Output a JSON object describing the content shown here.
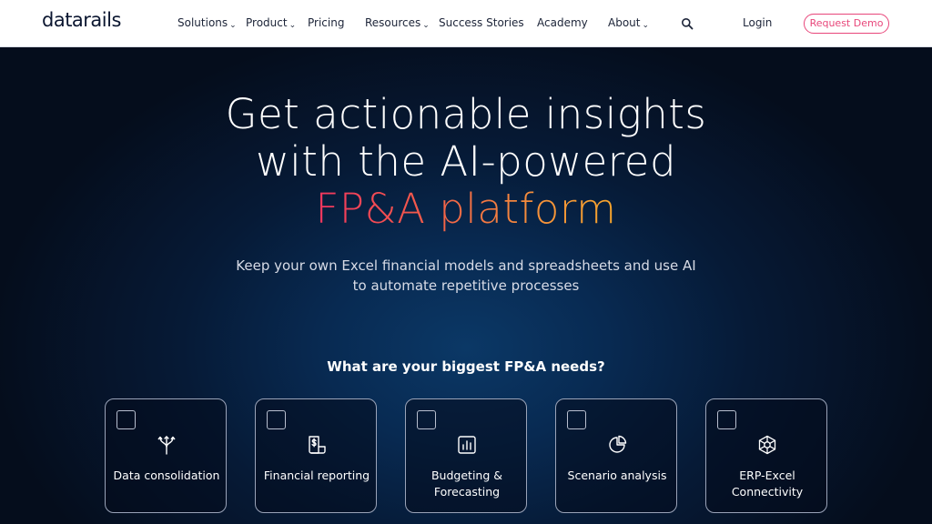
{
  "header": {
    "logo": "datarails",
    "nav": [
      {
        "label": "Solutions",
        "has_dropdown": true
      },
      {
        "label": "Product",
        "has_dropdown": true
      },
      {
        "label": "Pricing",
        "has_dropdown": false
      },
      {
        "label": "Resources",
        "has_dropdown": true
      },
      {
        "label": "Success Stories",
        "has_dropdown": false
      },
      {
        "label": "Academy",
        "has_dropdown": false
      },
      {
        "label": "About",
        "has_dropdown": true
      }
    ],
    "chevron": "⌄",
    "search_icon": "search-icon",
    "login": "Login",
    "cta": "Request Demo"
  },
  "hero": {
    "title_line1": "Get actionable insights",
    "title_line2": "with the AI-powered",
    "title_highlight": "FP&A platform",
    "subtitle_line1": "Keep your own Excel financial models and spreadsheets and use AI",
    "subtitle_line2": "to automate repetitive processes",
    "question": "What are your biggest FP&A needs?"
  },
  "needs": [
    {
      "label_1": "Data consolidation",
      "label_2": "",
      "icon": "merge-icon"
    },
    {
      "label_1": "Financial reporting",
      "label_2": "",
      "icon": "report-icon"
    },
    {
      "label_1": "Budgeting &",
      "label_2": "Forecasting",
      "icon": "bar-chart-icon"
    },
    {
      "label_1": "Scenario analysis",
      "label_2": "",
      "icon": "pie-chart-icon"
    },
    {
      "label_1": "ERP-Excel",
      "label_2": "Connectivity",
      "icon": "network-icon"
    }
  ],
  "colors": {
    "accent": "#e8467a",
    "gradient_start": "#f2365f",
    "gradient_end": "#f7a52c",
    "background": "#050d1c"
  }
}
